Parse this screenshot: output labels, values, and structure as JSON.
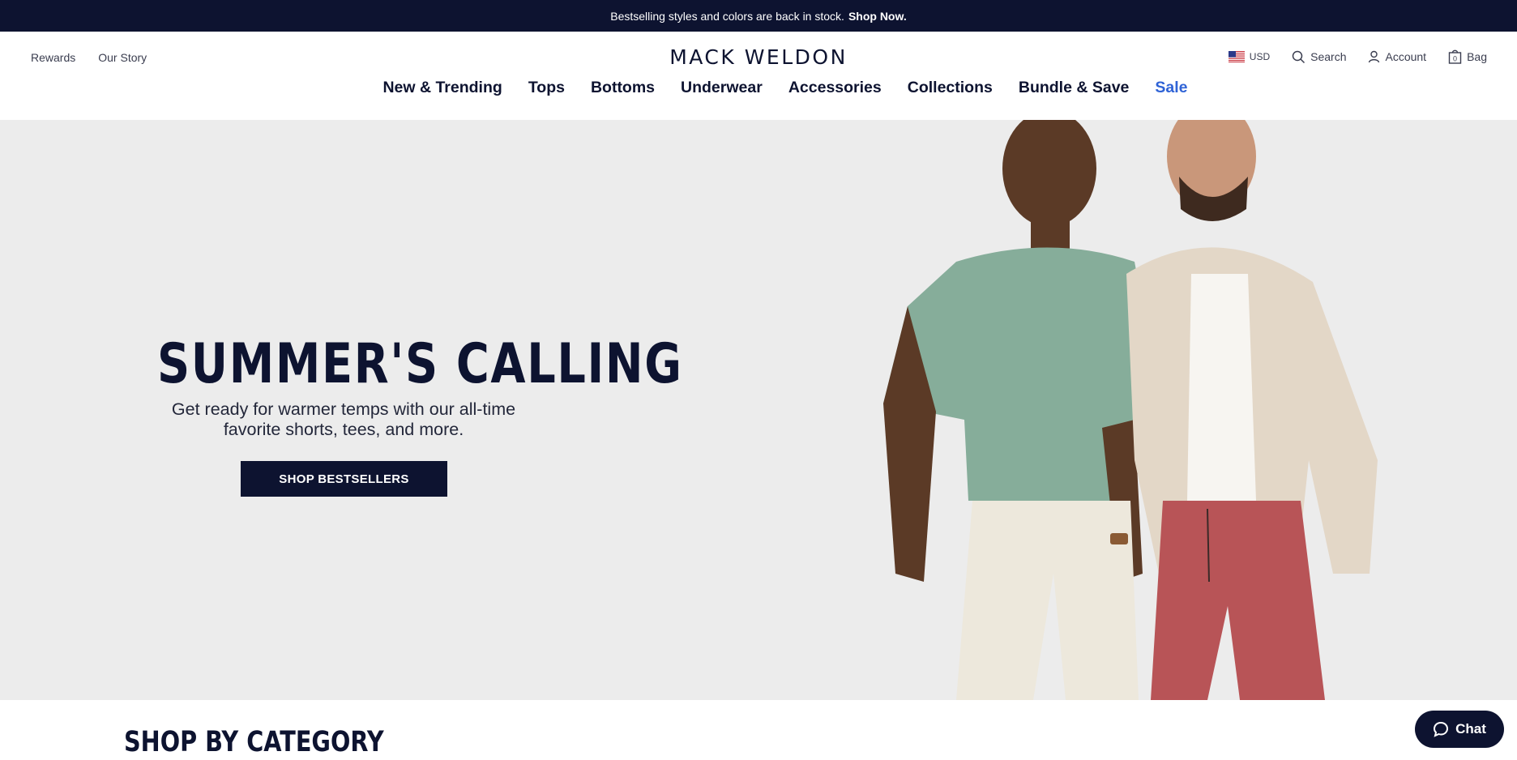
{
  "announcement": {
    "text": "Bestselling styles and colors are back in stock.",
    "link": "Shop Now."
  },
  "header": {
    "utility_left": [
      "Rewards",
      "Our Story"
    ],
    "logo": "MACK WELDON",
    "currency": "USD",
    "search_label": "Search",
    "account_label": "Account",
    "bag_label": "Bag",
    "bag_count": "0"
  },
  "nav": {
    "items": [
      "New & Trending",
      "Tops",
      "Bottoms",
      "Underwear",
      "Accessories",
      "Collections",
      "Bundle & Save",
      "Sale"
    ]
  },
  "hero": {
    "title": "SUMMER'S CALLING",
    "subtitle": "Get ready for warmer temps with our all-time favorite shorts, tees, and more.",
    "button": "SHOP BESTSELLERS"
  },
  "category": {
    "title": "SHOP BY CATEGORY"
  },
  "chat": {
    "label": "Chat"
  },
  "colors": {
    "navy": "#0d1330",
    "sale_blue": "#2f63d6",
    "hero_bg": "#ececec"
  }
}
